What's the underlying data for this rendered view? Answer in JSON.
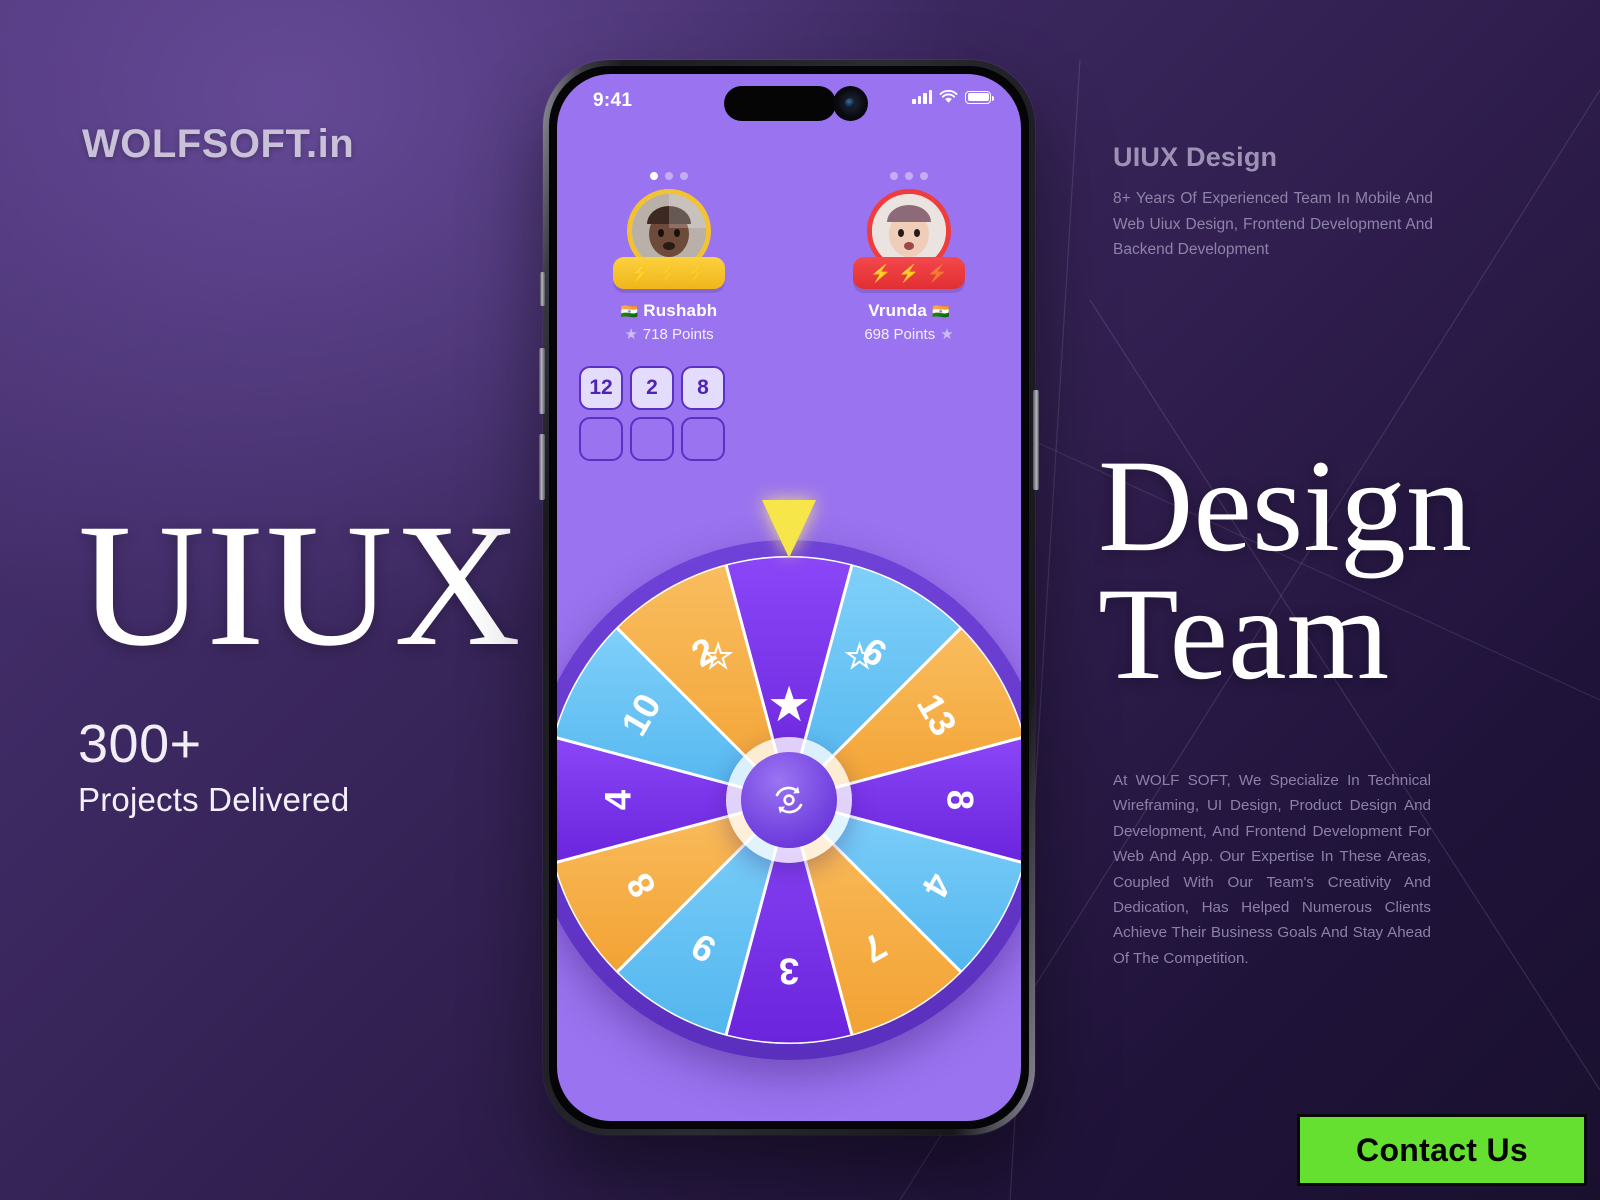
{
  "brand": {
    "logo": "WOLFSOFT.in"
  },
  "left": {
    "headline": "UIUX",
    "stat_number": "300+",
    "stat_label": "Projects Delivered"
  },
  "right": {
    "eyebrow": "UIUX Design",
    "eyebrow_body": "8+ Years Of Experienced Team In Mobile And Web Uiux Design, Frontend Development And Backend Development",
    "title_line1": "Design",
    "title_line2": "Team",
    "body": "At WOLF SOFT, We Specialize In Technical Wireframing, UI Design, Product Design And Development, And Frontend Development For Web And App. Our Expertise In These Areas, Coupled With Our Team's Creativity And Dedication, Has Helped Numerous Clients Achieve Their Business Goals And Stay Ahead Of The Competition.",
    "cta_label": "Contact Us",
    "cta_color": "#66e030"
  },
  "phone": {
    "status": {
      "time": "9:41",
      "signal_icon": "cellular-bars-icon",
      "wifi_icon": "wifi-icon",
      "battery_icon": "battery-icon"
    },
    "app": {
      "background": "#9a73f0",
      "players": [
        {
          "name": "Rushabh",
          "flag": "🇮🇳",
          "points": "718 Points",
          "ring_color": "#f2c230",
          "badge_color": "#f0b61c",
          "bolts_total": 3,
          "bolts_filled": 1,
          "dots_total": 3,
          "dots_active": 1
        },
        {
          "name": "Vrunda",
          "flag": "🇮🇳",
          "points": "698 Points",
          "ring_color": "#ef3d3d",
          "badge_color": "#e12f33",
          "bolts_total": 3,
          "bolts_filled": 2,
          "dots_total": 3,
          "dots_active": 0
        }
      ],
      "tiles": [
        {
          "value": "12",
          "filled": true
        },
        {
          "value": "2",
          "filled": true
        },
        {
          "value": "8",
          "filled": true
        },
        {
          "value": "",
          "filled": false
        },
        {
          "value": "",
          "filled": false
        },
        {
          "value": "",
          "filled": false
        }
      ],
      "wheel": {
        "pointer_color": "#f7e64a",
        "spin_button_icon": "refresh-spin-icon",
        "colors": {
          "purple": "#7b33ef",
          "orange": "#f7ae45",
          "blue": "#63c2f5"
        },
        "segments": [
          {
            "label": "★",
            "type": "star-filled",
            "color": "purple"
          },
          {
            "label": "6",
            "type": "number",
            "color": "blue"
          },
          {
            "label": "13",
            "type": "number",
            "color": "orange"
          },
          {
            "label": "8",
            "type": "number",
            "color": "purple"
          },
          {
            "label": "4",
            "type": "number",
            "color": "blue"
          },
          {
            "label": "7",
            "type": "number",
            "color": "orange"
          },
          {
            "label": "3",
            "type": "number",
            "color": "purple"
          },
          {
            "label": "9",
            "type": "number",
            "color": "blue"
          },
          {
            "label": "8",
            "type": "number",
            "color": "orange"
          },
          {
            "label": "4",
            "type": "number",
            "color": "purple"
          },
          {
            "label": "10",
            "type": "number",
            "color": "blue"
          },
          {
            "label": "2",
            "type": "number",
            "color": "orange"
          }
        ]
      }
    }
  }
}
